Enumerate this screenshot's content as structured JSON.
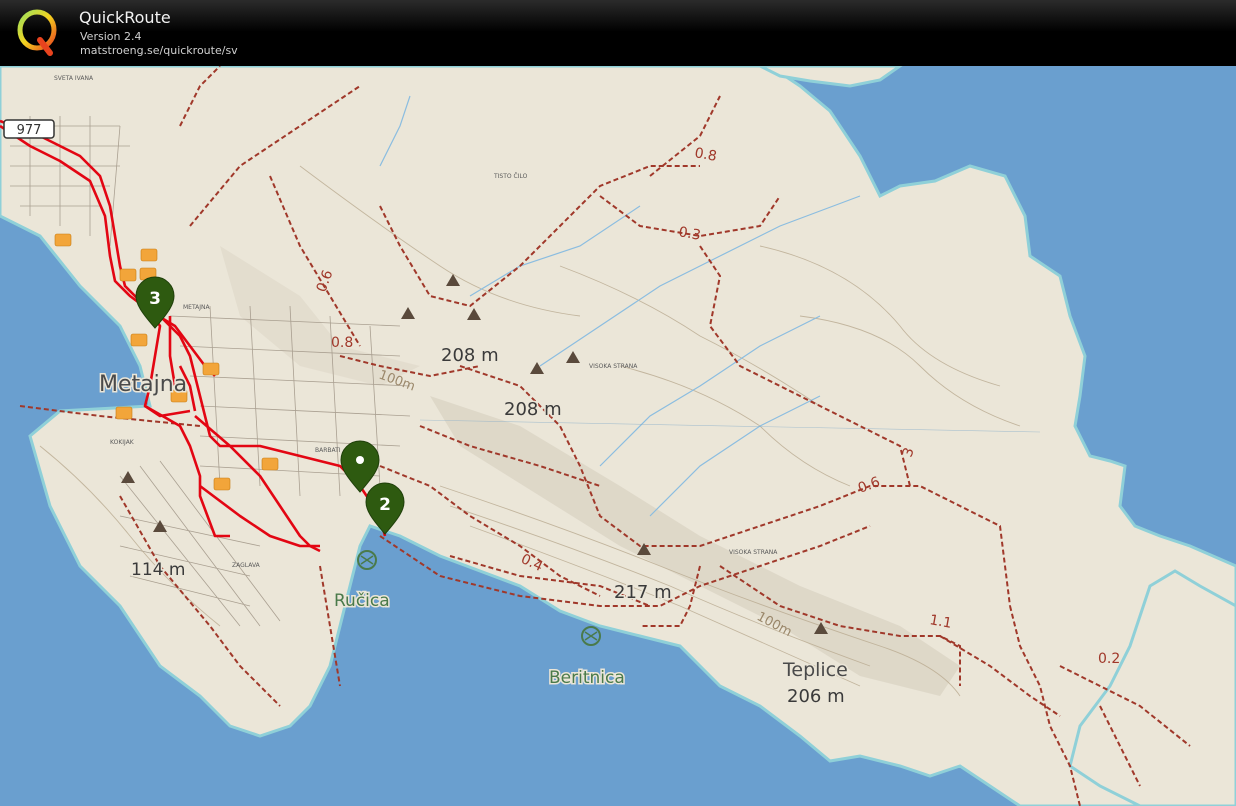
{
  "app": {
    "title": "QuickRoute",
    "version": "Version 2.4",
    "url": "matstroeng.se/quickroute/sv"
  },
  "colors": {
    "sea": "#6a9fcf",
    "land": "#ebe6d8",
    "route": "#e30613",
    "trail": "#a0382a",
    "marker": "#2e5a10",
    "note": "#f2a53a"
  },
  "map": {
    "places": {
      "metajna": "Metajna",
      "rucica": "Ručica",
      "beritnica": "Beritnica",
      "teplice": "Teplice"
    },
    "elevations": {
      "e208a": "208 m",
      "e208b": "208 m",
      "e217": "217 m",
      "e206": "206 m",
      "e114": "114 m"
    },
    "contours": {
      "c100a": "100m",
      "c100b": "100m"
    },
    "distances": {
      "d08a": "0.8",
      "d03": "0.3",
      "d06a": "0.6",
      "d08b": "0.8",
      "d06b": "0.6",
      "d3": "3",
      "d11": "1.1",
      "d02": "0.2",
      "d04": "0.4"
    },
    "road_number": "977",
    "small": {
      "sveta_ivana": "SVETA IVANA",
      "tisto_cilo": "TISTO ČILO",
      "metajna_small": "METAJNA",
      "visoka_strana_1": "VISOKA STRANA",
      "visoka_strana_2": "VISOKA STRANA",
      "barbati": "BARBATI",
      "zaglava": "ZAGLAVA",
      "kokijak": "KOKIJAK"
    },
    "markers": {
      "m3": "3",
      "m2": "2",
      "m1": ""
    }
  }
}
